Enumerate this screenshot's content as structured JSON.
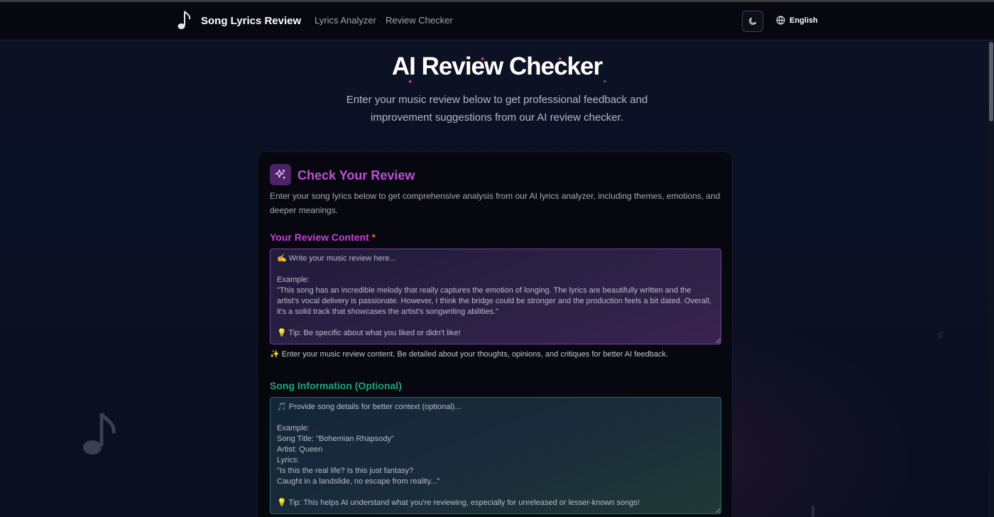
{
  "navbar": {
    "brand_name": "Song Lyrics Review",
    "links": [
      "Lyrics Analyzer",
      "Review Checker"
    ],
    "language": "English",
    "icons": {
      "brand": "music-note-icon",
      "theme": "moon-icon",
      "language": "globe-icon"
    }
  },
  "hero": {
    "title": "AI Review Checker",
    "subtitle": "Enter your music review below to get professional feedback and improvement suggestions from our AI review checker."
  },
  "card": {
    "icon": "sparkles-icon",
    "title": "Check Your Review",
    "description": "Enter your song lyrics below to get comprehensive analysis from our AI lyrics analyzer, including themes, emotions, and deeper meanings.",
    "review_field": {
      "label": "Your Review Content",
      "required_mark": "*",
      "value": "",
      "placeholder": "✍️ Write your music review here...\n\nExample:\n\"This song has an incredible melody that really captures the emotion of longing. The lyrics are beautifully written and the artist's vocal delivery is passionate. However, I think the bridge could be stronger and the production feels a bit dated. Overall, it's a solid track that showcases the artist's songwriting abilities.\"\n\n💡 Tip: Be specific about what you liked or didn't like!",
      "hint": "✨ Enter your music review content. Be detailed about your thoughts, opinions, and critiques for better AI feedback."
    },
    "song_field": {
      "label": "Song Information (Optional)",
      "value": "",
      "placeholder": "🎵 Provide song details for better context (optional)...\n\nExample:\nSong Title: \"Bohemian Rhapsody\"\nArtist: Queen\nLyrics:\n\"Is this the real life? Is this just fantasy?\nCaught in a landslide, no escape from reality...\"\n\n💡 Tip: This helps AI understand what you're reviewing, especially for unreleased or lesser-known songs!"
    }
  },
  "colors": {
    "accent_purple": "#c640d8",
    "accent_pink": "#ec4899",
    "accent_green": "#22a57a",
    "background": "#0b1020"
  }
}
